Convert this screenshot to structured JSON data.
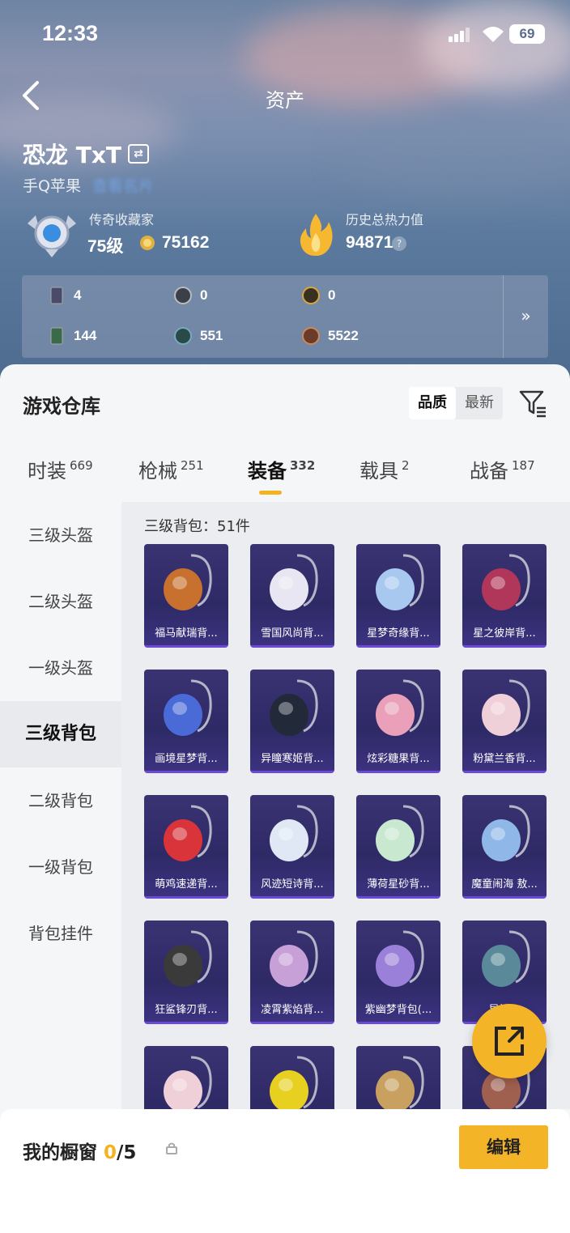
{
  "status_bar": {
    "time": "12:33",
    "battery": "69"
  },
  "nav": {
    "title": "资产"
  },
  "profile": {
    "name": "恐龙 TxT",
    "platform": "手Q苹果",
    "platform_extra": "查看名片",
    "collector_label": "传奇收藏家",
    "level": "75级",
    "coins": "75162",
    "heat_label": "历史总热力值",
    "heat_value": "94871",
    "help": "?"
  },
  "stats": [
    {
      "icon": "card-icon",
      "value": "4"
    },
    {
      "icon": "silver-medal-icon",
      "value": "0"
    },
    {
      "icon": "gold-medal-icon",
      "value": "0"
    },
    {
      "icon": "green-card-icon",
      "value": "144"
    },
    {
      "icon": "green-orb-icon",
      "value": "551"
    },
    {
      "icon": "bronze-orb-icon",
      "value": "5522"
    }
  ],
  "warehouse": {
    "title": "游戏仓库",
    "sort": [
      "品质",
      "最新"
    ],
    "tabs": [
      {
        "label": "时装",
        "count": "669"
      },
      {
        "label": "枪械",
        "count": "251"
      },
      {
        "label": "装备",
        "count": "332"
      },
      {
        "label": "载具",
        "count": "2"
      },
      {
        "label": "战备",
        "count": "187"
      }
    ],
    "sidebar": [
      "三级头盔",
      "二级头盔",
      "一级头盔",
      "三级背包",
      "二级背包",
      "一级背包",
      "背包挂件"
    ],
    "count_label": "三级背包：51件",
    "items": [
      {
        "name": "福马献瑞背...",
        "color": "#c8702e"
      },
      {
        "name": "雪国风尚背...",
        "color": "#e8e6f2"
      },
      {
        "name": "星梦奇缘背...",
        "color": "#a9c8f0"
      },
      {
        "name": "星之彼岸背...",
        "color": "#b0365a"
      },
      {
        "name": "画境星梦背...",
        "color": "#4a6ad8"
      },
      {
        "name": "异瞳寒姬背...",
        "color": "#222a3a"
      },
      {
        "name": "炫彩糖果背...",
        "color": "#e9a0b8"
      },
      {
        "name": "粉黛兰香背...",
        "color": "#f0d0d8"
      },
      {
        "name": "萌鸡速递背...",
        "color": "#d8343a"
      },
      {
        "name": "风迹短诗背...",
        "color": "#dfe8f4"
      },
      {
        "name": "薄荷星砂背...",
        "color": "#c8e8d0"
      },
      {
        "name": "魔童闹海 敖...",
        "color": "#8fb8e8"
      },
      {
        "name": "狂鲨锋刃背...",
        "color": "#3a3a3a"
      },
      {
        "name": "凌霄紫焰背...",
        "color": "#c8a0d8"
      },
      {
        "name": "紫幽梦背包(...",
        "color": "#9a80d8"
      },
      {
        "name": "异域...",
        "color": "#5a8a9a"
      },
      {
        "name": "",
        "color": "#f0d0d8"
      },
      {
        "name": "",
        "color": "#e8d020"
      },
      {
        "name": "",
        "color": "#c8a060"
      },
      {
        "name": "",
        "color": "#a06050"
      }
    ]
  },
  "showcase": {
    "label": "我的橱窗",
    "current": "0",
    "total": "/5",
    "edit": "编辑"
  },
  "colors": {
    "accent": "#f4b428",
    "card_bg": "#2e2a66"
  }
}
